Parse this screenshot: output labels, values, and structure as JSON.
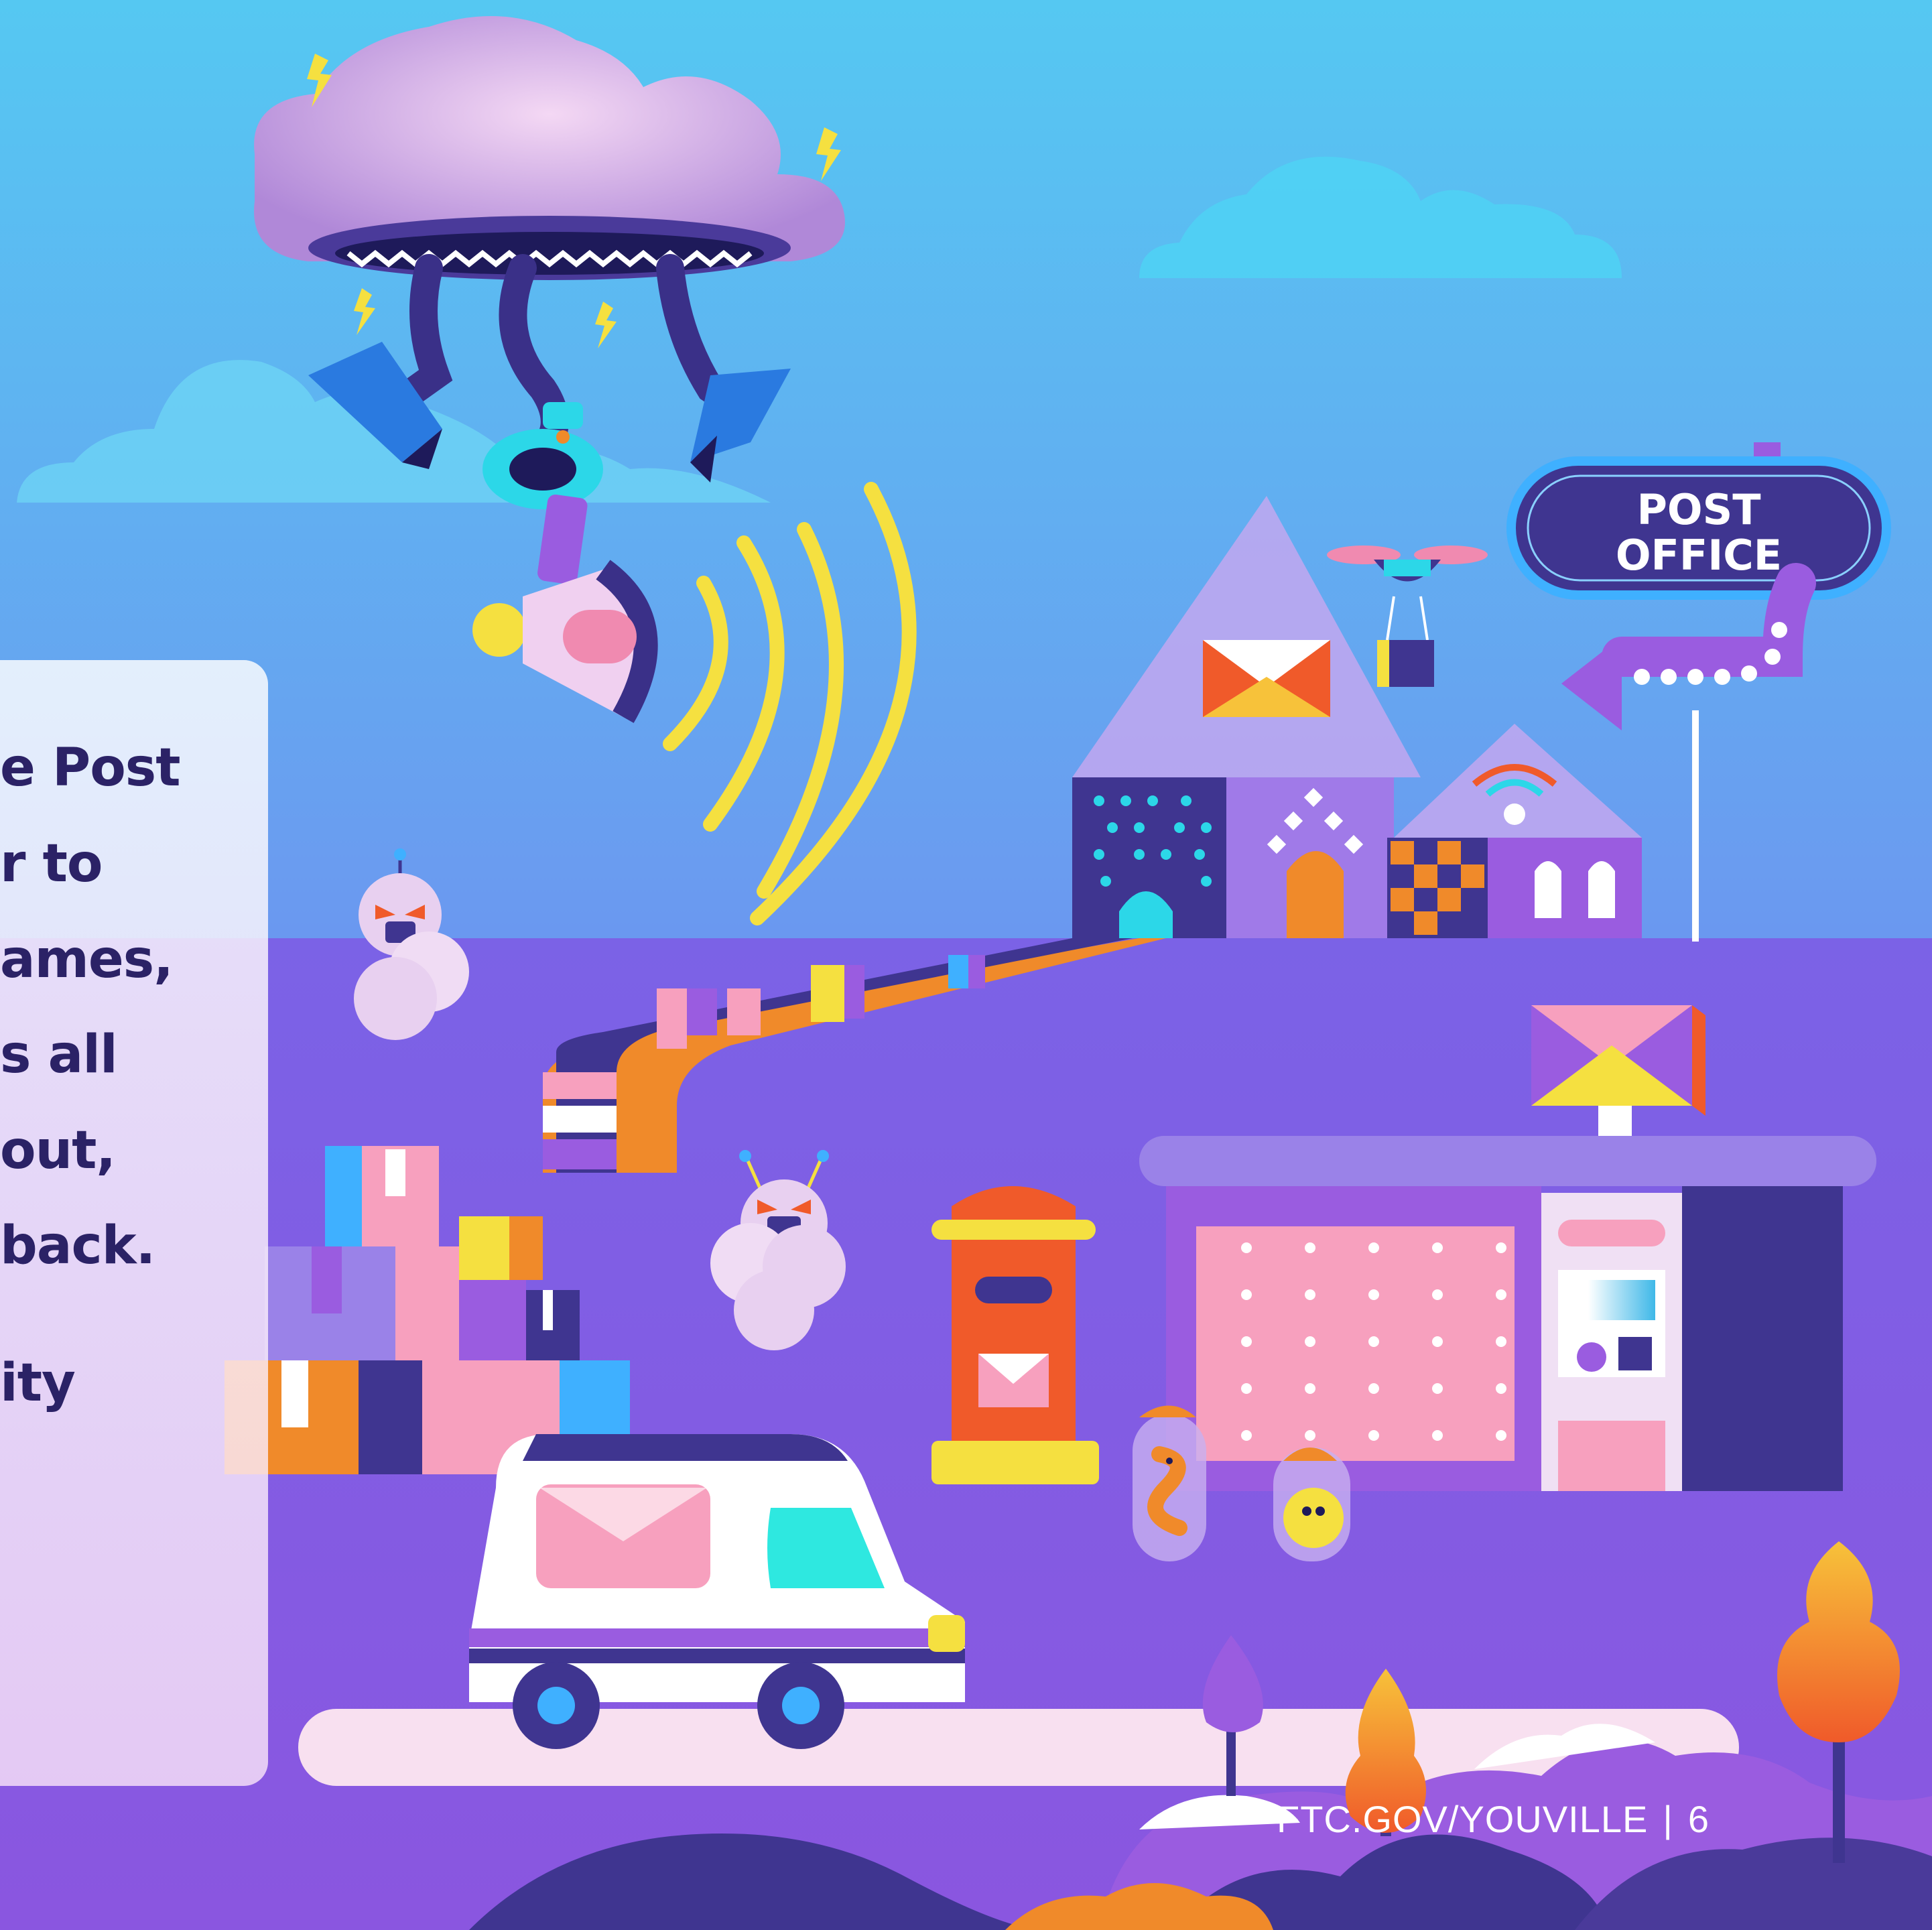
{
  "panel": {
    "lines": [
      "e Post",
      "r to",
      "ames,",
      "s all",
      "out,",
      " back.",
      "ity"
    ]
  },
  "sign": {
    "line1": "POST",
    "line2": "OFFICE"
  },
  "footer": {
    "url": "FTC.GOV/YOUVILLE",
    "separator": "|",
    "page": "6"
  },
  "colors": {
    "sky_top": "#55c8f2",
    "sky_bottom": "#6a5ce8",
    "ground": "#6848d8",
    "panel_text": "#2b2266",
    "sign_bg": "#3f3590",
    "sign_border": "#5ec8ff",
    "accent_yellow": "#f5e040",
    "accent_pink": "#f7a0be",
    "accent_orange": "#f08a2a"
  },
  "icons": [
    "storm-cloud-monster",
    "megaphone-icon",
    "post-office-sign",
    "drone-icon",
    "envelope-icon",
    "mailbox-icon",
    "mail-truck-icon",
    "package-stack",
    "parcel-locker",
    "tree-icon"
  ]
}
